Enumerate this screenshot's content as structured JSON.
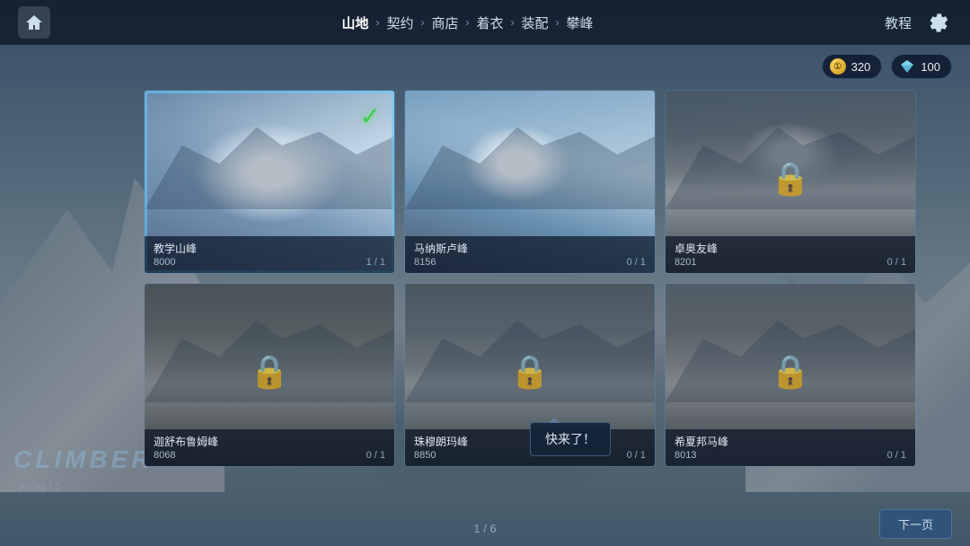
{
  "app": {
    "version": "pro.lag.1.1"
  },
  "topbar": {
    "home_label": "⌂",
    "nav_items": [
      {
        "label": "山地",
        "active": true
      },
      {
        "label": "契约",
        "active": false
      },
      {
        "label": "商店",
        "active": false
      },
      {
        "label": "着衣",
        "active": false
      },
      {
        "label": "装配",
        "active": false
      },
      {
        "label": "攀峰",
        "active": false
      }
    ],
    "tutorial_label": "教程",
    "settings_label": "⚙"
  },
  "currency": {
    "coin_value": "320",
    "gem_value": "100"
  },
  "mountains": [
    {
      "id": 1,
      "name": "教学山峰",
      "altitude": "8000",
      "progress": "1 / 1",
      "locked": false,
      "selected": true
    },
    {
      "id": 2,
      "name": "马纳斯卢峰",
      "altitude": "8156",
      "progress": "0 / 1",
      "locked": false,
      "selected": false
    },
    {
      "id": 3,
      "name": "卓奥友峰",
      "altitude": "8201",
      "progress": "0 / 1",
      "locked": true,
      "selected": false
    },
    {
      "id": 4,
      "name": "迦舒布鲁姆峰",
      "altitude": "8068",
      "progress": "0 / 1",
      "locked": true,
      "selected": false
    },
    {
      "id": 5,
      "name": "珠穆朗玛峰",
      "altitude": "8850",
      "progress": "0 / 1",
      "locked": true,
      "selected": false
    },
    {
      "id": 6,
      "name": "希夏邦马峰",
      "altitude": "8013",
      "progress": "0 / 1",
      "locked": true,
      "selected": false
    }
  ],
  "tooltip": {
    "text": "快来了！"
  },
  "pagination": {
    "current": "1 / 6"
  },
  "next_page_btn": "下一页",
  "climber_logo": "CLIMBER",
  "icons": {
    "lock": "🔒",
    "check": "✔",
    "chevron": "›",
    "coin": "①",
    "gem": "◆",
    "home": "🏠",
    "settings": "⚙"
  }
}
